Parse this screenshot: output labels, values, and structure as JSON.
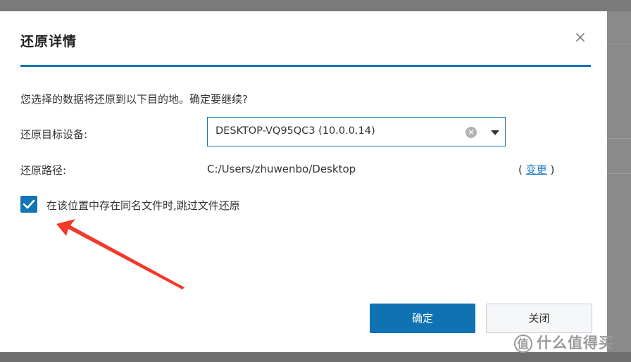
{
  "dialog": {
    "title": "还原详情",
    "close_icon": "close-icon",
    "prompt": "您选择的数据将还原到以下目的地。确定要继续?",
    "device_label": "还原目标设备:",
    "device_value": "DESKTOP-VQ95QC3 (10.0.0.14)",
    "path_label": "还原路径:",
    "path_value": "C:/Users/zhuwenbo/Desktop",
    "change_open": "(",
    "change_label": "变更",
    "change_close": ")",
    "skip_checkbox": {
      "checked": true,
      "label": "在该位置中存在同名文件时,跳过文件还原"
    },
    "ok_label": "确定",
    "close_label": "关闭"
  },
  "annotation": {
    "color": "#f23a2a",
    "icon": "red-arrow-icon"
  },
  "watermark": {
    "logo": "值",
    "text": "什么值得买"
  },
  "colors": {
    "accent": "#1275b5",
    "link": "#1a78c2"
  }
}
